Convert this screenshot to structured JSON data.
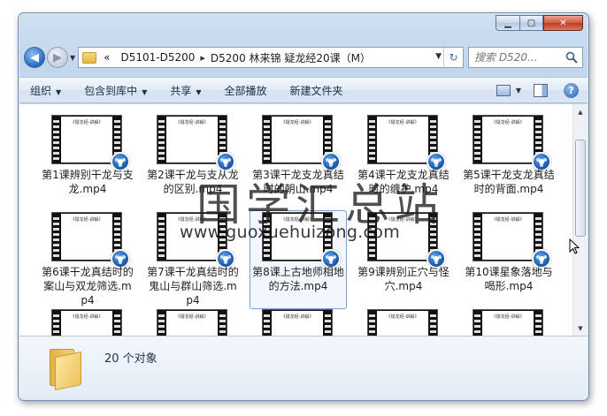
{
  "addressbar": {
    "overflow": "«",
    "crumbs": [
      "D5101-D5200",
      "D5200 林来锦 疑龙经20课（M）"
    ]
  },
  "search": {
    "placeholder": "搜索 D520..."
  },
  "toolbar": {
    "organize": "组织",
    "include_in_library": "包含到库中",
    "share": "共享",
    "play_all": "全部播放",
    "new_folder": "新建文件夹"
  },
  "thumbnail_caption": "《疑龙经-讲解》",
  "files": [
    {
      "label": "第1课辨别干龙与支龙.mp4"
    },
    {
      "label": "第2课干龙与支从龙的区别.mp4"
    },
    {
      "label": "第3课干龙支龙真结时的朝山.mp4"
    },
    {
      "label": "第4课干龙支龙真结时的缠护.mp4"
    },
    {
      "label": "第5课干龙支龙真结时的背面.mp4"
    },
    {
      "label": "第6课干龙真结时的案山与双龙筛选.mp4"
    },
    {
      "label": "第7课干龙真结时的鬼山与群山筛选.mp4"
    },
    {
      "label": "第8课上古地师相地的方法.mp4"
    },
    {
      "label": "第9课辨别正穴与怪穴.mp4"
    },
    {
      "label": "第10课星象落地与喝形.mp4"
    },
    {
      "label": ""
    },
    {
      "label": ""
    },
    {
      "label": ""
    },
    {
      "label": ""
    },
    {
      "label": ""
    }
  ],
  "watermark": {
    "text_cn": "国学汇总站",
    "url": "www.guoxuehuizong.com"
  },
  "details": {
    "count": "20 个对象"
  }
}
